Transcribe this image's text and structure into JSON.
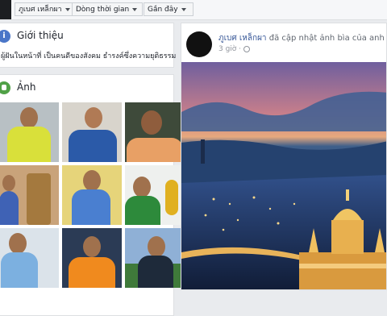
{
  "topbar": {
    "filters": [
      {
        "label": "ภูเบศ เหล็กผา"
      },
      {
        "label": "Dòng thời gian"
      },
      {
        "label": "Gần đây"
      }
    ]
  },
  "intro": {
    "title": "Giới thiệu",
    "bio": "ผู้ฝันในหน้าที่ เป็นคนดีของสังคม ธำรงค์ซึ่งความยุติธรรม"
  },
  "photos": {
    "title": "Ảnh",
    "items": [
      {
        "label": "photo-1"
      },
      {
        "label": "photo-2"
      },
      {
        "label": "photo-3"
      },
      {
        "label": "photo-4"
      },
      {
        "label": "photo-5"
      },
      {
        "label": "photo-6"
      },
      {
        "label": "photo-7"
      },
      {
        "label": "photo-8"
      },
      {
        "label": "photo-9"
      }
    ]
  },
  "post": {
    "author": "ภูเบศ เหล็กผา",
    "action": "đã cập nhật ảnh bìa của anh ấy.",
    "time": "3 giờ ·"
  },
  "colors": {
    "link": "#385898",
    "intro_icon": "#4a76c8",
    "photo_icon": "#50a147"
  }
}
